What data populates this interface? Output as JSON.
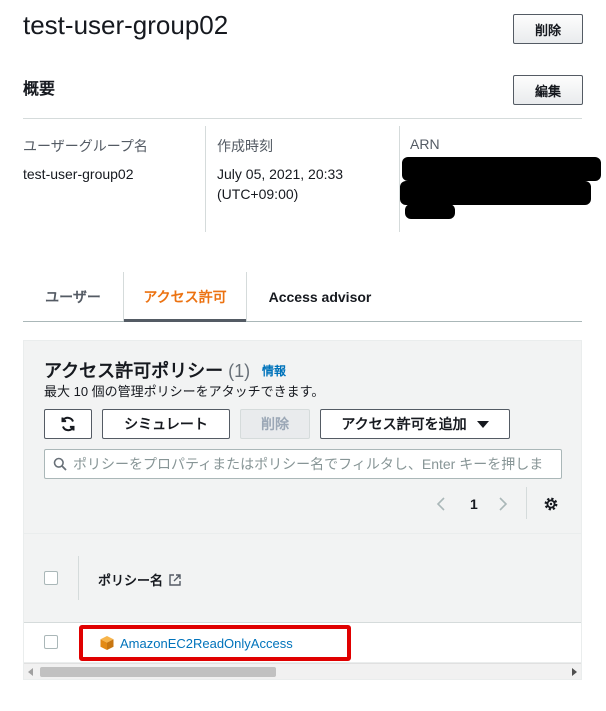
{
  "header": {
    "title": "test-user-group02",
    "delete_label": "削除"
  },
  "summary": {
    "heading": "概要",
    "edit_label": "編集",
    "group_name_label": "ユーザーグループ名",
    "group_name_value": "test-user-group02",
    "created_label": "作成時刻",
    "created_value_line1": "July 05, 2021, 20:33",
    "created_value_line2": "(UTC+09:00)",
    "arn_label": "ARN"
  },
  "tabs": [
    {
      "label": "ユーザー",
      "active": false
    },
    {
      "label": "アクセス許可",
      "active": true
    },
    {
      "label": "Access advisor",
      "active": false
    }
  ],
  "permissions": {
    "title": "アクセス許可ポリシー",
    "count": "(1)",
    "info_label": "情報",
    "description": "最大 10 個の管理ポリシーをアタッチできます。",
    "simulate_label": "シミュレート",
    "delete_label": "削除",
    "add_label": "アクセス許可を追加",
    "search_placeholder": "ポリシーをプロパティまたはポリシー名でフィルタし、Enter キーを押しま",
    "page_current": "1",
    "column_policy_name": "ポリシー名",
    "rows": [
      {
        "name": "AmazonEC2ReadOnlyAccess"
      }
    ]
  },
  "colors": {
    "accent": "#ec7211",
    "link": "#0073bb",
    "highlight": "#e00000"
  }
}
